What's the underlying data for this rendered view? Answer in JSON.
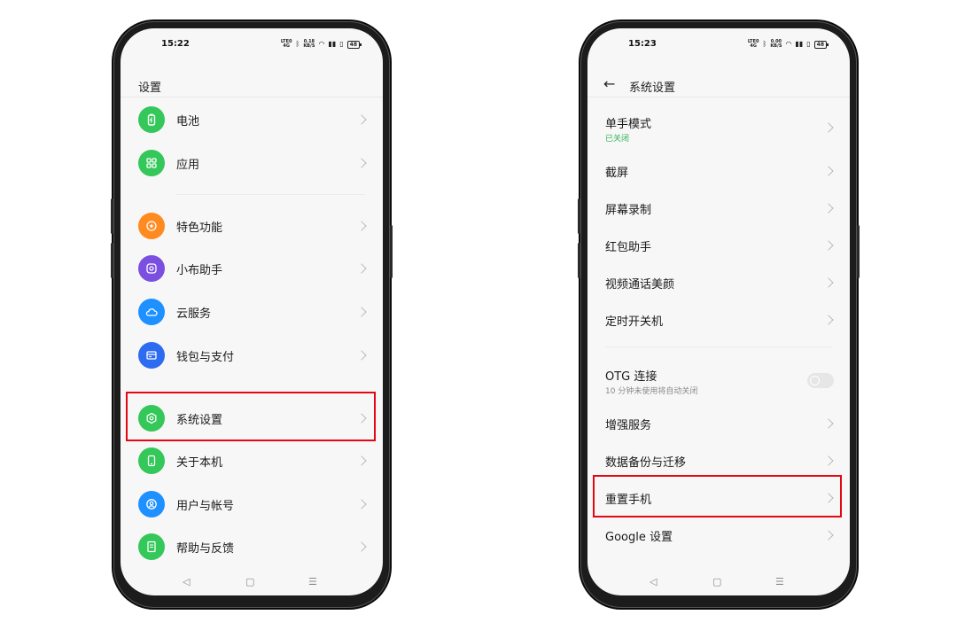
{
  "left_phone": {
    "status": {
      "time": "15:22",
      "lte": "LTE0\n4G",
      "speed": "0.18\nKB/S",
      "battery": "48"
    },
    "header": {
      "title": "设置"
    },
    "items": [
      {
        "label": "电池",
        "icon": "battery-icon",
        "color": "#34c759"
      },
      {
        "label": "应用",
        "icon": "apps-grid-icon",
        "color": "#34c759"
      },
      {
        "label": "特色功能",
        "icon": "star-badge-icon",
        "color": "#ff8a1f"
      },
      {
        "label": "小布助手",
        "icon": "assistant-icon",
        "color": "#7b4fe0"
      },
      {
        "label": "云服务",
        "icon": "cloud-icon",
        "color": "#1e90ff"
      },
      {
        "label": "钱包与支付",
        "icon": "wallet-icon",
        "color": "#2d6bf0"
      },
      {
        "label": "系统设置",
        "icon": "hexagon-gear-icon",
        "color": "#34c759"
      },
      {
        "label": "关于本机",
        "icon": "phone-icon",
        "color": "#34c759"
      },
      {
        "label": "用户与帐号",
        "icon": "user-icon",
        "color": "#1e90ff"
      },
      {
        "label": "帮助与反馈",
        "icon": "help-book-icon",
        "color": "#34c759"
      }
    ]
  },
  "right_phone": {
    "status": {
      "time": "15:23",
      "lte": "LTE0\n4G",
      "speed": "0.00\nKB/S",
      "battery": "48"
    },
    "header": {
      "title": "系统设置"
    },
    "items": [
      {
        "label": "单手模式",
        "sub": "已关闭",
        "sub_color": "#2fb152"
      },
      {
        "label": "截屏"
      },
      {
        "label": "屏幕录制"
      },
      {
        "label": "红包助手"
      },
      {
        "label": "视频通话美颜"
      },
      {
        "label": "定时开关机"
      },
      {
        "label": "OTG 连接",
        "sub": "10 分钟未使用将自动关闭",
        "sub_color": "#8a8a8a",
        "toggle": "off"
      },
      {
        "label": "增强服务"
      },
      {
        "label": "数据备份与迁移"
      },
      {
        "label": "重置手机"
      },
      {
        "label": "Google 设置"
      }
    ]
  },
  "nav": {
    "back": "◁",
    "home": "▢",
    "recents": "☰"
  },
  "highlight_color": "#e30613"
}
